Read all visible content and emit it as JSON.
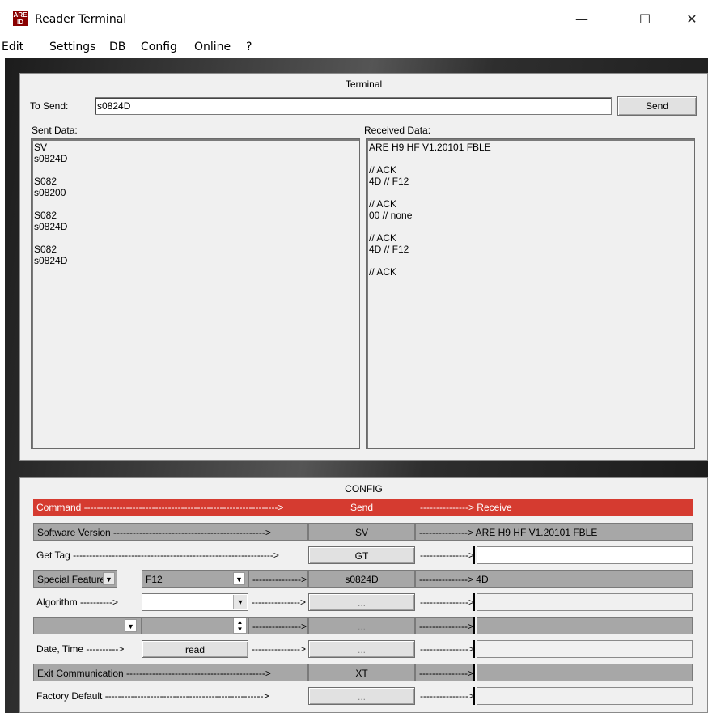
{
  "window": {
    "title": "Reader Terminal",
    "icon_text_top": "ARE",
    "icon_text_bottom": "ID",
    "min_glyph": "—",
    "max_glyph": "☐",
    "close_glyph": "✕"
  },
  "menu": [
    "Edit",
    "Settings",
    "DB",
    "Config",
    "Online",
    "?"
  ],
  "terminal": {
    "title": "Terminal",
    "to_send_label": "To Send:",
    "to_send_value": "s0824D",
    "send_button": "Send",
    "sent_label": "Sent Data:",
    "received_label": "Received Data:",
    "sent_log": "SV\ns0824D\n\nS082\ns08200\n\nS082\ns0824D\n\nS082\ns0824D",
    "received_log": "ARE H9 HF V1.20101 FBLE\n\n// ACK\n4D // F12\n\n// ACK\n00 // none\n\n// ACK\n4D // F12\n\n// ACK"
  },
  "config": {
    "title": "CONFIG",
    "header": {
      "command": "Command ------------------------------------------------------------>",
      "send": "Send",
      "receive": "---------------> Receive"
    },
    "rows": {
      "sw_version": {
        "label": "Software Version ----------------------------------------------->",
        "send": "SV",
        "arrow": "---------------> ARE H9 HF V1.20101 FBLE"
      },
      "get_tag": {
        "label": "Get Tag -------------------------------------------------------------->",
        "send": "GT",
        "arrow": "--------------->",
        "value": ""
      },
      "special": {
        "label": "Special Features",
        "option": "F12",
        "arrow1": "--------------->",
        "send": "s0824D",
        "arrow2": "---------------> 4D"
      },
      "algorithm": {
        "label": "Algorithm ---------->",
        "option": "",
        "arrow1": "--------------->",
        "send": "...",
        "arrow2": "--------------->",
        "value": ""
      },
      "blank": {
        "arrow1": "--------------->",
        "send": "...",
        "arrow2": "--------------->",
        "value": ""
      },
      "datetime": {
        "label": "Date, Time ---------->",
        "button": "read",
        "arrow1": "--------------->",
        "send": "...",
        "arrow2": "--------------->",
        "value": ""
      },
      "exit": {
        "label": "Exit Communication ------------------------------------------->",
        "send": "XT",
        "arrow": "--------------->",
        "value": ""
      },
      "factory": {
        "label": "Factory Default ------------------------------------------------->",
        "send": "...",
        "arrow": "--------------->",
        "value": ""
      }
    }
  },
  "colors": {
    "header_red": "#d53b30",
    "grey_row": "#a7a7a7",
    "panel_bg": "#f0f0f0"
  }
}
